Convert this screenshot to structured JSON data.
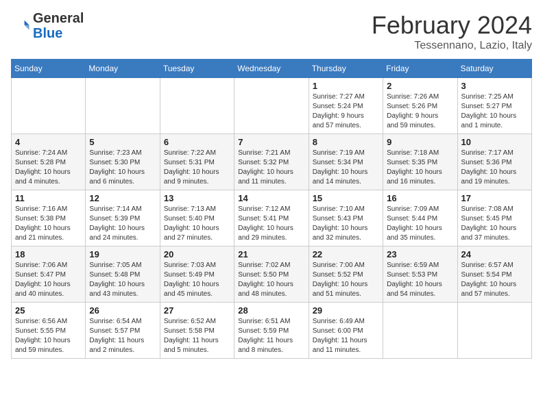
{
  "header": {
    "logo": {
      "general": "General",
      "blue": "Blue"
    },
    "title": "February 2024",
    "location": "Tessennano, Lazio, Italy"
  },
  "weekdays": [
    "Sunday",
    "Monday",
    "Tuesday",
    "Wednesday",
    "Thursday",
    "Friday",
    "Saturday"
  ],
  "weeks": [
    [
      {
        "day": "",
        "info": ""
      },
      {
        "day": "",
        "info": ""
      },
      {
        "day": "",
        "info": ""
      },
      {
        "day": "",
        "info": ""
      },
      {
        "day": "1",
        "info": "Sunrise: 7:27 AM\nSunset: 5:24 PM\nDaylight: 9 hours\nand 57 minutes."
      },
      {
        "day": "2",
        "info": "Sunrise: 7:26 AM\nSunset: 5:26 PM\nDaylight: 9 hours\nand 59 minutes."
      },
      {
        "day": "3",
        "info": "Sunrise: 7:25 AM\nSunset: 5:27 PM\nDaylight: 10 hours\nand 1 minute."
      }
    ],
    [
      {
        "day": "4",
        "info": "Sunrise: 7:24 AM\nSunset: 5:28 PM\nDaylight: 10 hours\nand 4 minutes."
      },
      {
        "day": "5",
        "info": "Sunrise: 7:23 AM\nSunset: 5:30 PM\nDaylight: 10 hours\nand 6 minutes."
      },
      {
        "day": "6",
        "info": "Sunrise: 7:22 AM\nSunset: 5:31 PM\nDaylight: 10 hours\nand 9 minutes."
      },
      {
        "day": "7",
        "info": "Sunrise: 7:21 AM\nSunset: 5:32 PM\nDaylight: 10 hours\nand 11 minutes."
      },
      {
        "day": "8",
        "info": "Sunrise: 7:19 AM\nSunset: 5:34 PM\nDaylight: 10 hours\nand 14 minutes."
      },
      {
        "day": "9",
        "info": "Sunrise: 7:18 AM\nSunset: 5:35 PM\nDaylight: 10 hours\nand 16 minutes."
      },
      {
        "day": "10",
        "info": "Sunrise: 7:17 AM\nSunset: 5:36 PM\nDaylight: 10 hours\nand 19 minutes."
      }
    ],
    [
      {
        "day": "11",
        "info": "Sunrise: 7:16 AM\nSunset: 5:38 PM\nDaylight: 10 hours\nand 21 minutes."
      },
      {
        "day": "12",
        "info": "Sunrise: 7:14 AM\nSunset: 5:39 PM\nDaylight: 10 hours\nand 24 minutes."
      },
      {
        "day": "13",
        "info": "Sunrise: 7:13 AM\nSunset: 5:40 PM\nDaylight: 10 hours\nand 27 minutes."
      },
      {
        "day": "14",
        "info": "Sunrise: 7:12 AM\nSunset: 5:41 PM\nDaylight: 10 hours\nand 29 minutes."
      },
      {
        "day": "15",
        "info": "Sunrise: 7:10 AM\nSunset: 5:43 PM\nDaylight: 10 hours\nand 32 minutes."
      },
      {
        "day": "16",
        "info": "Sunrise: 7:09 AM\nSunset: 5:44 PM\nDaylight: 10 hours\nand 35 minutes."
      },
      {
        "day": "17",
        "info": "Sunrise: 7:08 AM\nSunset: 5:45 PM\nDaylight: 10 hours\nand 37 minutes."
      }
    ],
    [
      {
        "day": "18",
        "info": "Sunrise: 7:06 AM\nSunset: 5:47 PM\nDaylight: 10 hours\nand 40 minutes."
      },
      {
        "day": "19",
        "info": "Sunrise: 7:05 AM\nSunset: 5:48 PM\nDaylight: 10 hours\nand 43 minutes."
      },
      {
        "day": "20",
        "info": "Sunrise: 7:03 AM\nSunset: 5:49 PM\nDaylight: 10 hours\nand 45 minutes."
      },
      {
        "day": "21",
        "info": "Sunrise: 7:02 AM\nSunset: 5:50 PM\nDaylight: 10 hours\nand 48 minutes."
      },
      {
        "day": "22",
        "info": "Sunrise: 7:00 AM\nSunset: 5:52 PM\nDaylight: 10 hours\nand 51 minutes."
      },
      {
        "day": "23",
        "info": "Sunrise: 6:59 AM\nSunset: 5:53 PM\nDaylight: 10 hours\nand 54 minutes."
      },
      {
        "day": "24",
        "info": "Sunrise: 6:57 AM\nSunset: 5:54 PM\nDaylight: 10 hours\nand 57 minutes."
      }
    ],
    [
      {
        "day": "25",
        "info": "Sunrise: 6:56 AM\nSunset: 5:55 PM\nDaylight: 10 hours\nand 59 minutes."
      },
      {
        "day": "26",
        "info": "Sunrise: 6:54 AM\nSunset: 5:57 PM\nDaylight: 11 hours\nand 2 minutes."
      },
      {
        "day": "27",
        "info": "Sunrise: 6:52 AM\nSunset: 5:58 PM\nDaylight: 11 hours\nand 5 minutes."
      },
      {
        "day": "28",
        "info": "Sunrise: 6:51 AM\nSunset: 5:59 PM\nDaylight: 11 hours\nand 8 minutes."
      },
      {
        "day": "29",
        "info": "Sunrise: 6:49 AM\nSunset: 6:00 PM\nDaylight: 11 hours\nand 11 minutes."
      },
      {
        "day": "",
        "info": ""
      },
      {
        "day": "",
        "info": ""
      }
    ]
  ]
}
